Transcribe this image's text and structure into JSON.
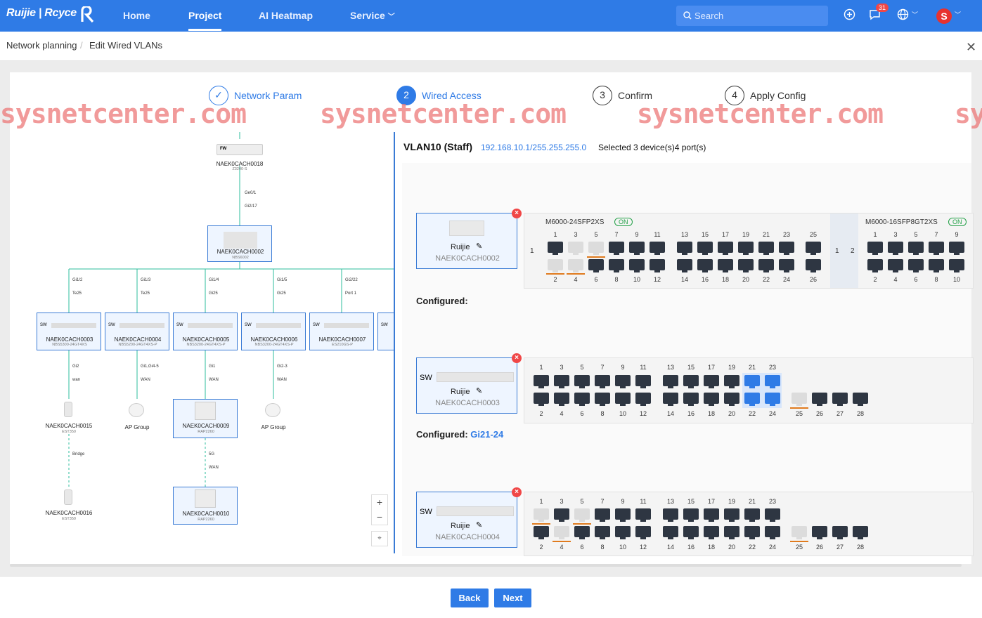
{
  "topbar": {
    "logo": "Ruijie | Rcyce",
    "nav": [
      "Home",
      "Project",
      "AI Heatmap",
      "Service"
    ],
    "search_placeholder": "Search",
    "notifications": "31",
    "avatar": "S"
  },
  "breadcrumb": [
    "Network planning",
    "Edit Wired VLANs"
  ],
  "steps": [
    {
      "num": "✓",
      "label": "Network Param",
      "state": "done"
    },
    {
      "num": "2",
      "label": "Wired Access",
      "state": "active"
    },
    {
      "num": "3",
      "label": "Confirm",
      "state": "todo"
    },
    {
      "num": "4",
      "label": "Apply Config",
      "state": "todo"
    }
  ],
  "watermark": "sysnetcenter.com",
  "topology": {
    "root": {
      "name": "NAEK0CACH0018",
      "model": "Z3200-S",
      "tag": "FW"
    },
    "root_links": [
      "Ge0/1",
      "Gi2/17"
    ],
    "core": {
      "name": "NAEK0CACH0002",
      "model": "NBS6002"
    },
    "access": [
      {
        "name": "NAEK0CACH0003",
        "model": "NBS5300-24GT4XS",
        "up": [
          "Gi1/2",
          "Te25"
        ],
        "down": [
          "Gi2",
          "wan"
        ]
      },
      {
        "name": "NAEK0CACH0004",
        "model": "NBS5200-24GT4XS-P",
        "up": [
          "Gi1/3",
          "Te25"
        ],
        "down": [
          "Gi1,Gi4-5",
          "WAN"
        ]
      },
      {
        "name": "NAEK0CACH0005",
        "model": "NBS3200-24GT4XS-P",
        "up": [
          "Gi1/4",
          "Gi25"
        ],
        "down": [
          "Gi1",
          "WAN"
        ]
      },
      {
        "name": "NAEK0CACH0006",
        "model": "NBS3200-24GT4XS-P",
        "up": [
          "Gi1/5",
          "Gi25"
        ],
        "down": [
          "Gi2-3",
          "WAN"
        ]
      },
      {
        "name": "NAEK0CACH0007",
        "model": "ES210GS-P",
        "up": [
          "Gi2/22",
          "Port 1"
        ],
        "down": []
      }
    ],
    "sw_tag": "SW",
    "leaf": [
      {
        "name": "NAEK0CACH0015",
        "model": "EST350"
      },
      {
        "name": "AP Group",
        "model": ""
      },
      {
        "name": "NAEK0CACH0009",
        "model": "RAP2260"
      },
      {
        "name": "AP Group",
        "model": ""
      }
    ],
    "leaf_links": [
      "Bridge",
      "5G",
      "WAN"
    ],
    "bottom": [
      {
        "name": "NAEK0CACH0016",
        "model": "EST350"
      },
      {
        "name": "NAEK0CACH0010",
        "model": "RAP2260"
      }
    ]
  },
  "vlan": {
    "title": "VLAN10 (Staff)",
    "ip": "192.168.10.1/255.255.255.0",
    "selected": "Selected 3 device(s)4 port(s)"
  },
  "devices": [
    {
      "brand": "Ruijie",
      "name": "NAEK0CACH0002",
      "configured_label": "Configured:",
      "configured_value": "",
      "slots": [
        {
          "model": "M6000-24SFP2XS",
          "status": "ON",
          "slot": "1",
          "top": [
            "1",
            "3",
            "5",
            "7",
            "9",
            "11",
            "13",
            "15",
            "17",
            "19",
            "21",
            "23",
            "25"
          ],
          "bottom": [
            "2",
            "4",
            "6",
            "8",
            "10",
            "12",
            "14",
            "16",
            "18",
            "20",
            "22",
            "24",
            "26"
          ]
        },
        {
          "model": "M6000-16SFP8GT2XS",
          "status": "ON",
          "slot": "2",
          "top": [
            "1",
            "3",
            "5",
            "7",
            "9"
          ],
          "bottom": [
            "2",
            "4",
            "6",
            "8",
            "10"
          ]
        }
      ]
    },
    {
      "brand": "Ruijie",
      "name": "NAEK0CACH0003",
      "tag": "SW",
      "configured_label": "Configured:",
      "configured_value": "Gi21-24",
      "top": [
        "1",
        "3",
        "5",
        "7",
        "9",
        "11",
        "13",
        "15",
        "17",
        "19",
        "21",
        "23"
      ],
      "bottom": [
        "2",
        "4",
        "6",
        "8",
        "10",
        "12",
        "14",
        "16",
        "18",
        "20",
        "22",
        "24",
        "25",
        "26",
        "27",
        "28"
      ]
    },
    {
      "brand": "Ruijie",
      "name": "NAEK0CACH0004",
      "tag": "SW",
      "top": [
        "1",
        "3",
        "5",
        "7",
        "9",
        "11",
        "13",
        "15",
        "17",
        "19",
        "21",
        "23"
      ],
      "bottom": [
        "2",
        "4",
        "6",
        "8",
        "10",
        "12",
        "14",
        "16",
        "18",
        "20",
        "22",
        "24",
        "25",
        "26",
        "27",
        "28"
      ]
    }
  ],
  "zoom": {
    "in": "+",
    "out": "−"
  },
  "buttons": {
    "back": "Back",
    "next": "Next"
  }
}
